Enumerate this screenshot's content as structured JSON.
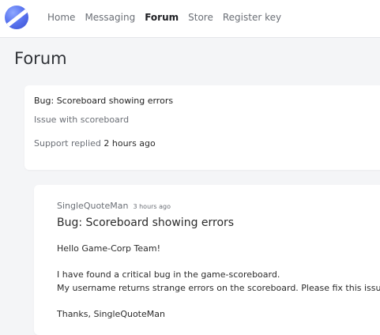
{
  "nav": {
    "items": [
      {
        "label": "Home",
        "active": false
      },
      {
        "label": "Messaging",
        "active": false
      },
      {
        "label": "Forum",
        "active": true
      },
      {
        "label": "Store",
        "active": false
      },
      {
        "label": "Register key",
        "active": false
      }
    ]
  },
  "page": {
    "title": "Forum"
  },
  "summary": {
    "title": "Bug: Scoreboard showing errors",
    "description": "Issue with scoreboard",
    "replied_by": "Support replied",
    "replied_time": "2 hours ago"
  },
  "post": {
    "author": "SingleQuoteMan",
    "time": "3 hours ago",
    "title": "Bug: Scoreboard showing errors",
    "greeting": "Hello Game-Corp Team!",
    "body_line1": "I have found a critical bug in the game-scoreboard.",
    "body_line2": "My username returns strange errors on the scoreboard. Please fix this issue!",
    "signoff": "Thanks, SingleQuoteMan"
  },
  "colors": {
    "accent": "#5b76f0",
    "background": "#f4f5f7"
  }
}
